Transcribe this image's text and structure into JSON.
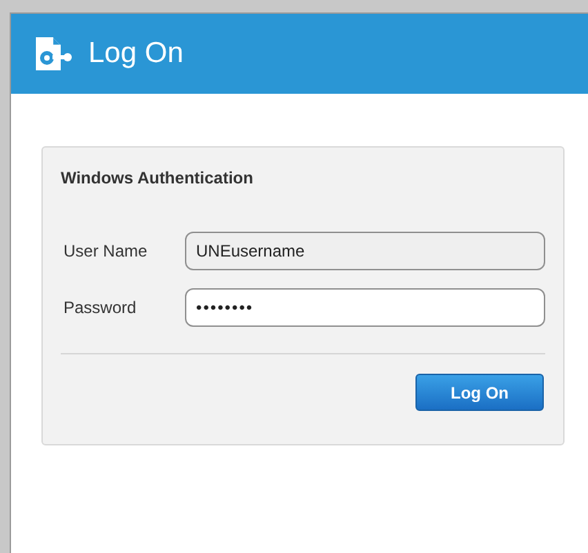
{
  "window": {
    "title": "Log On"
  },
  "panel": {
    "title": "Windows Authentication",
    "fields": [
      {
        "label": "User Name",
        "value": "UNEusername",
        "focused": false
      },
      {
        "label": "Password",
        "value": "••••••••",
        "focused": true
      }
    ],
    "buttons": [
      "Log On"
    ]
  }
}
